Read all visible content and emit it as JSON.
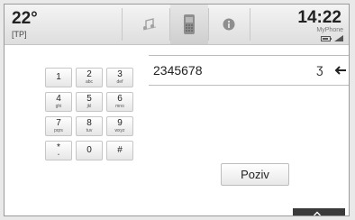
{
  "header": {
    "temperature": "22°",
    "station": "[TP]",
    "time": "14:22",
    "phone_name": "MyPhone",
    "tabs": [
      {
        "icon": "music-note-icon"
      },
      {
        "icon": "phone-icon",
        "active": true
      },
      {
        "icon": "info-icon"
      }
    ]
  },
  "dialer": {
    "number": "2345678",
    "mode_glyph": "ʒ",
    "call_label": "Poziv"
  },
  "keypad": [
    {
      "digit": "1",
      "letters": ""
    },
    {
      "digit": "2",
      "letters": "abc"
    },
    {
      "digit": "3",
      "letters": "def"
    },
    {
      "digit": "4",
      "letters": "ghi"
    },
    {
      "digit": "5",
      "letters": "jkl"
    },
    {
      "digit": "6",
      "letters": "mno"
    },
    {
      "digit": "7",
      "letters": "pqrs"
    },
    {
      "digit": "8",
      "letters": "tuv"
    },
    {
      "digit": "9",
      "letters": "wxyz"
    },
    {
      "digit": "*",
      "letters": "•"
    },
    {
      "digit": "0",
      "letters": ""
    },
    {
      "digit": "#",
      "letters": ""
    }
  ],
  "colors": {
    "background": "#ffffff",
    "header": "#dedede",
    "text": "#222222",
    "bottom_bar": "#3a3a3a"
  }
}
